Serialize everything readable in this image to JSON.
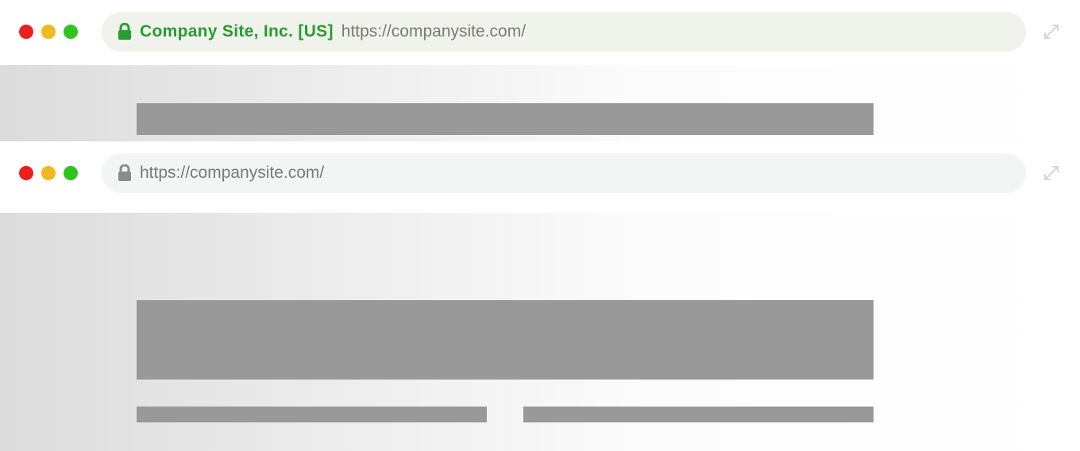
{
  "windows": [
    {
      "ev_badge": "Company Site, Inc. [US]",
      "url": "https://companysite.com/",
      "lock_color": "#2a9b2f",
      "has_ev": true
    },
    {
      "ev_badge": "",
      "url": "https://companysite.com/",
      "lock_color": "#8b8b8b",
      "has_ev": false
    }
  ],
  "traffic_light_colors": {
    "red": "#ec1f1f",
    "yellow": "#f0b91f",
    "green": "#2fc41f"
  }
}
